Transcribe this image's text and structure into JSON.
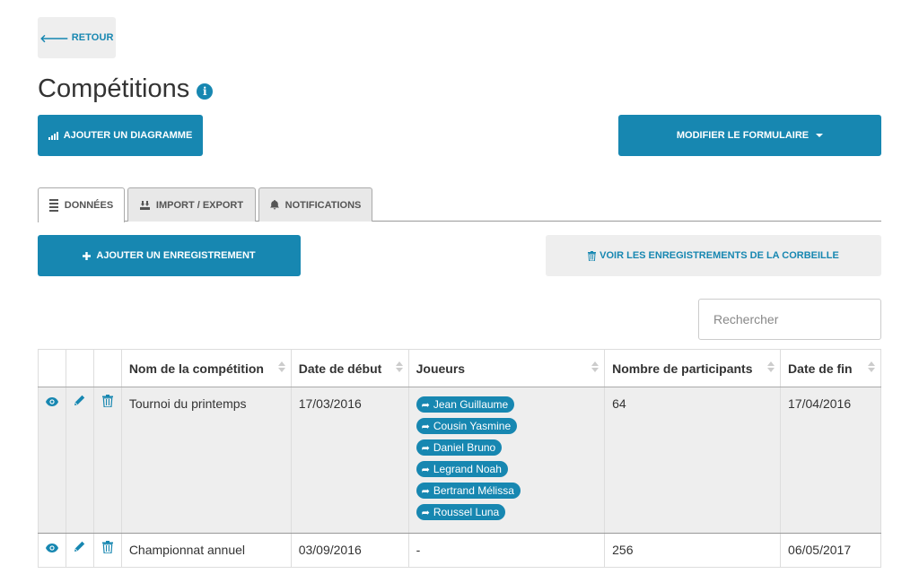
{
  "back_button": {
    "label": "RETOUR"
  },
  "page": {
    "title": "Compétitions"
  },
  "toolbar": {
    "add_chart_label": "AJOUTER UN DIAGRAMME",
    "edit_form_label": "MODIFIER LE FORMULAIRE"
  },
  "tabs": [
    {
      "label": "DONNÉES",
      "active": true
    },
    {
      "label": "IMPORT / EXPORT",
      "active": false
    },
    {
      "label": "NOTIFICATIONS",
      "active": false
    }
  ],
  "actions": {
    "add_record_label": "AJOUTER UN ENREGISTREMENT",
    "trash_label": "VOIR LES ENREGISTREMENTS DE LA CORBEILLE"
  },
  "search": {
    "placeholder": "Rechercher"
  },
  "table": {
    "columns": [
      "Nom de la compétition",
      "Date de début",
      "Joueurs",
      "Nombre de participants",
      "Date de fin"
    ],
    "rows": [
      {
        "name": "Tournoi du printemps",
        "start": "17/03/2016",
        "players": [
          "Jean Guillaume",
          "Cousin Yasmine",
          "Daniel Bruno",
          "Legrand Noah",
          "Bertrand Mélissa",
          "Roussel Luna"
        ],
        "participants": "64",
        "end": "17/04/2016"
      },
      {
        "name": "Championnat annuel",
        "start": "03/09/2016",
        "players_text": "-",
        "participants": "256",
        "end": "06/05/2017"
      }
    ]
  },
  "colors": {
    "accent": "#1787b1",
    "button_grey": "#eeeeee",
    "row_grey": "#eeeeee"
  }
}
